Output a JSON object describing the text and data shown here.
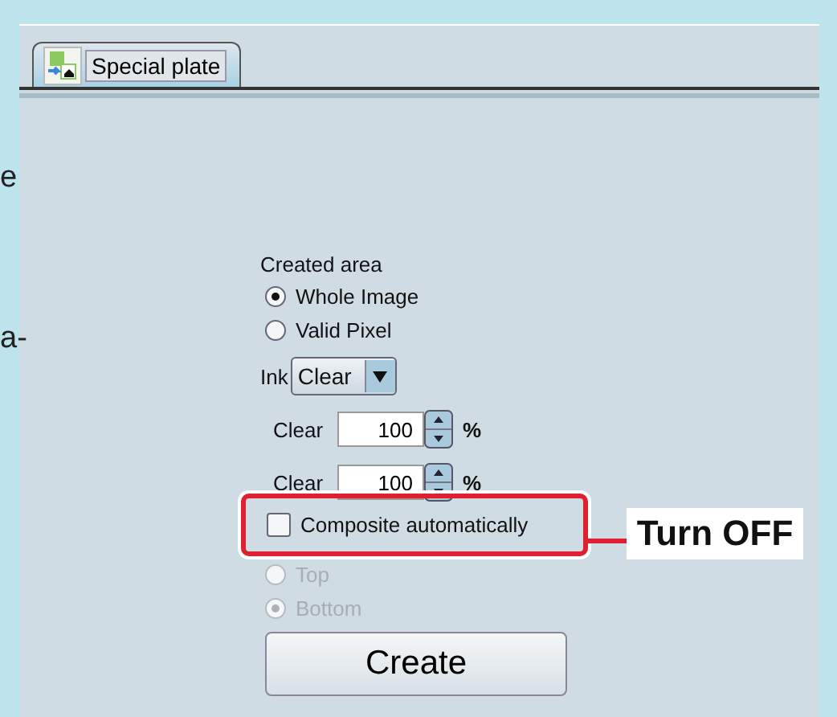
{
  "side_text": [
    "e",
    "a-"
  ],
  "tabs": [
    {
      "label": "Special plate",
      "selected": true
    }
  ],
  "created_area": {
    "label": "Created area",
    "options": [
      {
        "label": "Whole Image",
        "selected": true,
        "disabled": false
      },
      {
        "label": "Valid Pixel",
        "selected": false,
        "disabled": false
      }
    ]
  },
  "ink": {
    "label": "Ink",
    "value": "Clear"
  },
  "spinners": [
    {
      "label": "Clear",
      "value": "100",
      "unit": "%"
    },
    {
      "label": "Clear",
      "value": "100",
      "unit": "%"
    }
  ],
  "composite": {
    "label": "Composite automatically",
    "checked": false
  },
  "layer_options": [
    {
      "label": "Top",
      "selected": false,
      "disabled": true
    },
    {
      "label": "Bottom",
      "selected": true,
      "disabled": true
    }
  ],
  "create_button": "Create",
  "callout": "Turn OFF"
}
